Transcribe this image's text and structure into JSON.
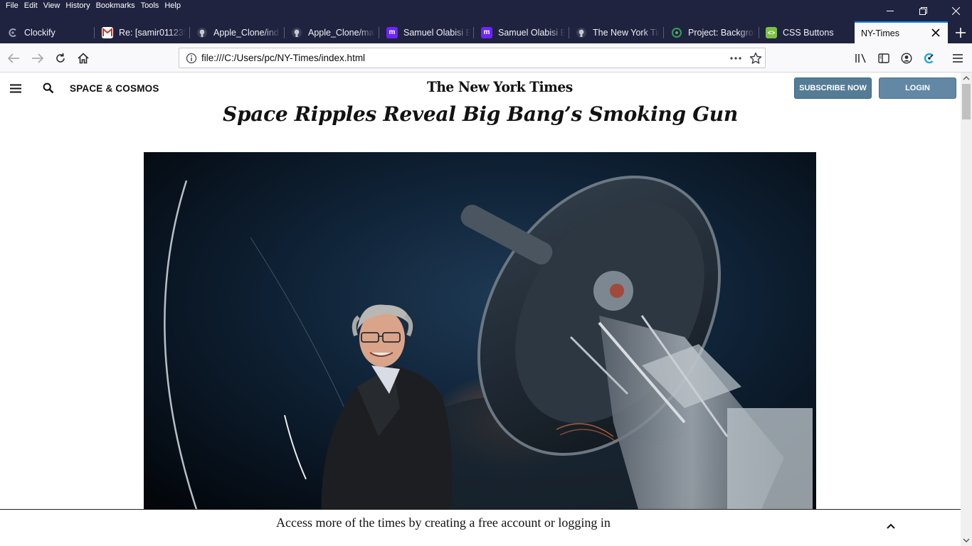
{
  "menubar": {
    "items": [
      "File",
      "Edit",
      "View",
      "History",
      "Bookmarks",
      "Tools",
      "Help"
    ]
  },
  "tabs": [
    {
      "title": "Clockify",
      "icon": "clockify-icon"
    },
    {
      "title": "Re: [samir011235/",
      "icon": "gmail-icon"
    },
    {
      "title": "Apple_Clone/ind",
      "icon": "github-icon"
    },
    {
      "title": "Apple_Clone/ma",
      "icon": "github-icon"
    },
    {
      "title": "Samuel Olabisi B",
      "icon": "microverse-icon"
    },
    {
      "title": "Samuel Olabisi B",
      "icon": "microverse-icon"
    },
    {
      "title": "The New York Tin",
      "icon": "github-icon"
    },
    {
      "title": "Project: Backgrou",
      "icon": "project-icon"
    },
    {
      "title": "CSS Buttons",
      "icon": "css-icon"
    },
    {
      "title": "NY-Times",
      "icon": "none",
      "active": true
    }
  ],
  "navbar": {
    "url": "file:///C:/Users/pc/NY-Times/index.html"
  },
  "page": {
    "section": "SPACE & COSMOS",
    "logo": "The New York Times",
    "subscribe": "SUBSCRIBE NOW",
    "login": "LOGIN",
    "headline": "Space Ripples Reveal Big Bang’s Smoking Gun",
    "bottom_message": "Access more of the times by creating a free account or logging in"
  },
  "colors": {
    "chrome": "#202340",
    "accent": "#0a84ff",
    "subscribe_bg": "#567b95",
    "login_bg": "#6288a5"
  }
}
